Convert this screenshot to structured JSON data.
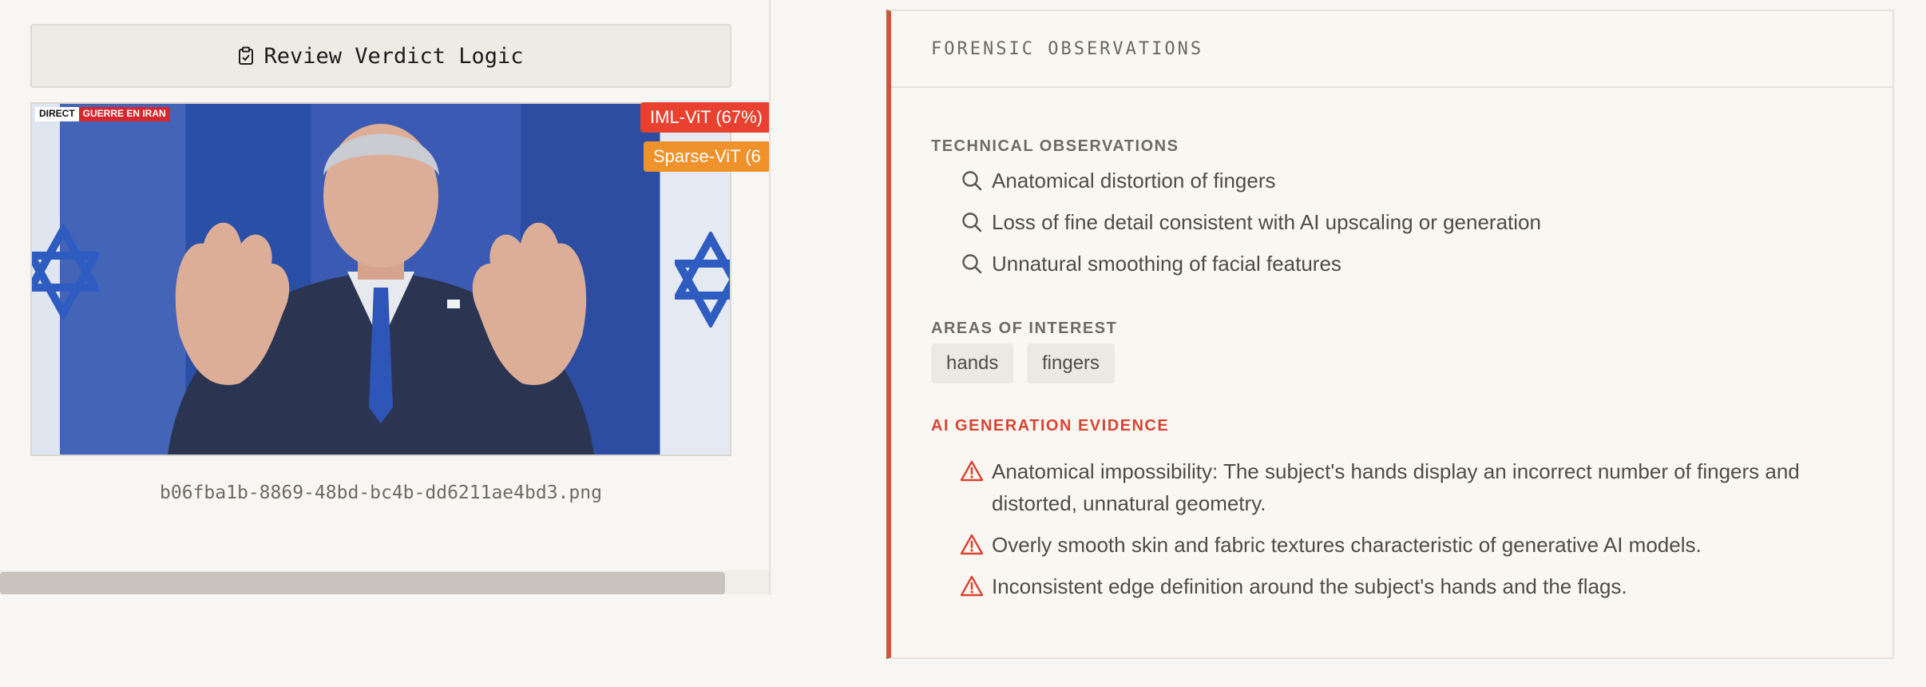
{
  "left_panel": {
    "review_button_label": "Review Verdict Logic",
    "image": {
      "overlay_live": "DIRECT",
      "overlay_topic": "GUERRE EN IRAN",
      "detections": [
        {
          "label": "IML-ViT (67%)",
          "color": "#e8412f"
        },
        {
          "label": "Sparse-ViT (6",
          "color": "#f0922b"
        }
      ]
    },
    "filename": "b06fba1b-8869-48bd-bc4b-dd6211ae4bd3.png"
  },
  "observations": {
    "header": "FORENSIC OBSERVATIONS",
    "technical": {
      "title": "TECHNICAL OBSERVATIONS",
      "items": [
        "Anatomical distortion of fingers",
        "Loss of fine detail consistent with AI upscaling or generation",
        "Unnatural smoothing of facial features"
      ]
    },
    "areas": {
      "title": "AREAS OF INTEREST",
      "tags": [
        "hands",
        "fingers"
      ]
    },
    "evidence": {
      "title": "AI GENERATION EVIDENCE",
      "items": [
        "Anatomical impossibility: The subject's hands display an incorrect number of fingers and distorted, unnatural geometry.",
        "Overly smooth skin and fabric textures characteristic of generative AI models.",
        "Inconsistent edge definition around the subject's hands and the flags."
      ]
    },
    "accent_color": "#c9573c",
    "danger_color": "#d84433"
  }
}
